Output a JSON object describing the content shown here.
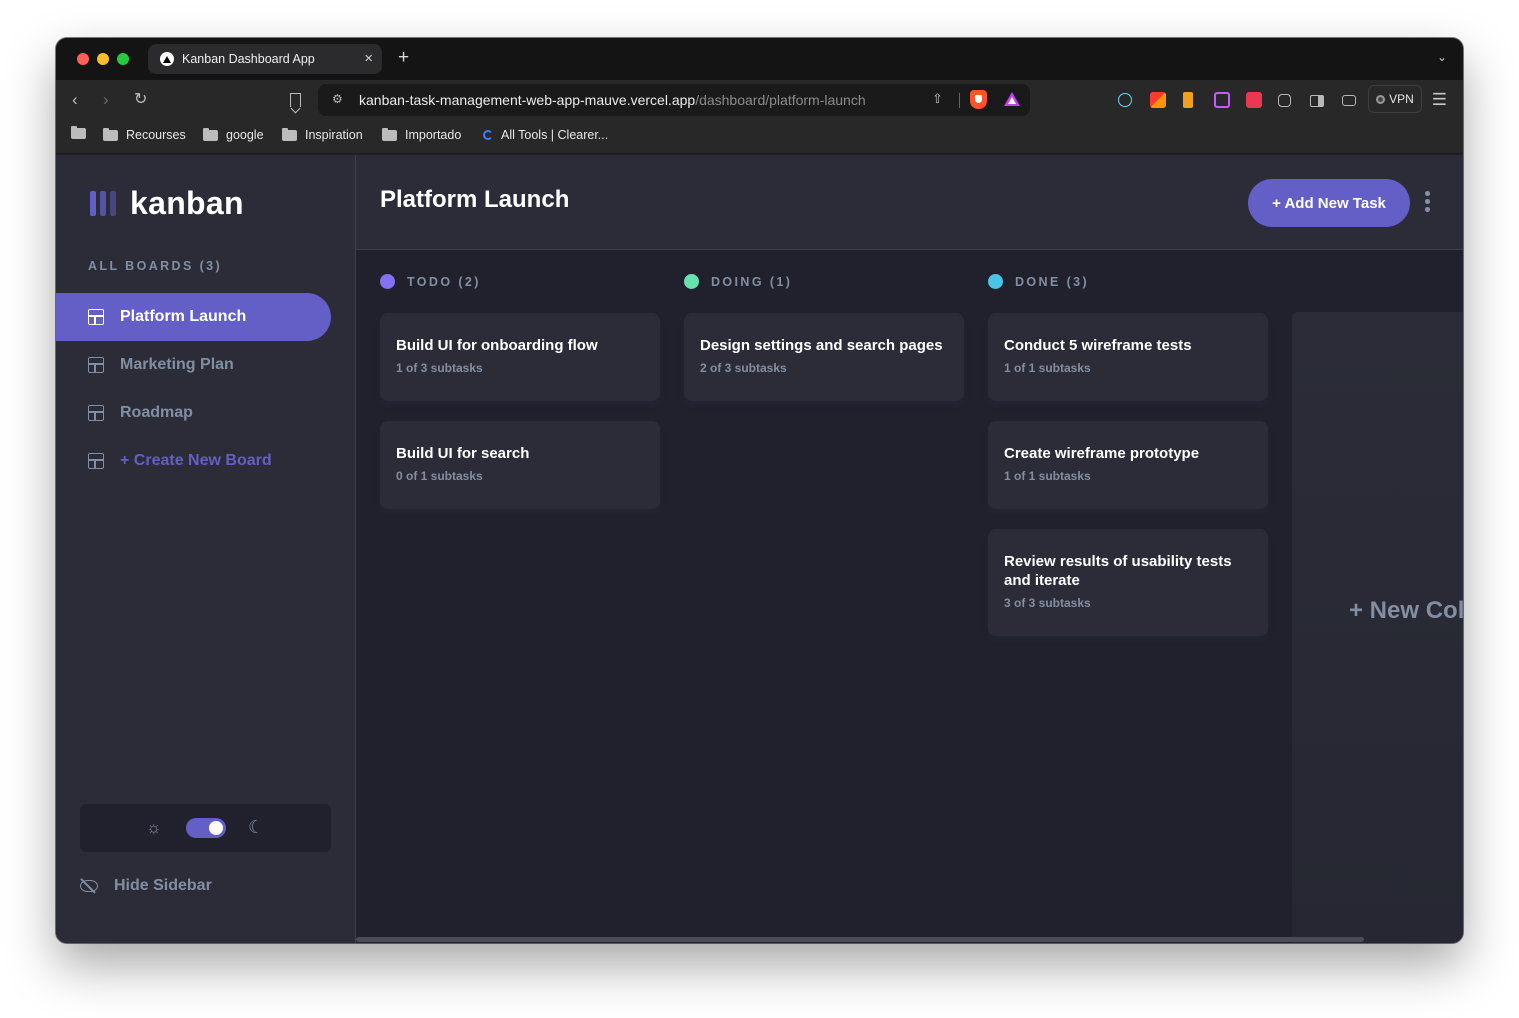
{
  "browser": {
    "tab_title": "Kanban Dashboard App",
    "tab_close": "×",
    "new_tab": "+",
    "url_domain": "kanban-task-management-web-app-mauve.vercel.app",
    "url_path": "/dashboard/platform-launch",
    "vpn_label": "VPN",
    "bookmarks": [
      "Recourses",
      "google",
      "Inspiration",
      "Importado",
      "All Tools | Clearer..."
    ]
  },
  "sidebar": {
    "logo": "kanban",
    "all_boards": "ALL BOARDS (3)",
    "boards": [
      "Platform Launch",
      "Marketing Plan",
      "Roadmap"
    ],
    "create_board": "+ Create New Board",
    "hide_sidebar": "Hide Sidebar",
    "theme": "dark"
  },
  "header": {
    "title": "Platform Launch",
    "add_task": "+ Add New Task"
  },
  "columns": [
    {
      "label": "TODO (2)",
      "color": "#49c4e5",
      "cards": [
        {
          "title": "Build UI for onboarding flow",
          "sub": "1 of 3 subtasks"
        },
        {
          "title": "Build UI for search",
          "sub": "0 of 1 subtasks"
        }
      ]
    },
    {
      "label": "DOING (1)",
      "color": "#8471f2",
      "cards": [
        {
          "title": "Design settings and search pages",
          "sub": "2 of 3 subtasks"
        }
      ]
    },
    {
      "label": "DONE (3)",
      "color": "#67e2ae",
      "cards": [
        {
          "title": "Conduct 5 wireframe tests",
          "sub": "1 of 1 subtasks"
        },
        {
          "title": "Create wireframe prototype",
          "sub": "1 of 1 subtasks"
        },
        {
          "title": "Review results of usability tests and iterate",
          "sub": "3 of 3 subtasks"
        }
      ]
    }
  ],
  "new_column_label": "+ New Column",
  "colors": {
    "accent": "#635fc7",
    "todo_dot": "#8471f2",
    "doing_dot": "#67e2ae",
    "done_dot": "#49c4e5"
  }
}
